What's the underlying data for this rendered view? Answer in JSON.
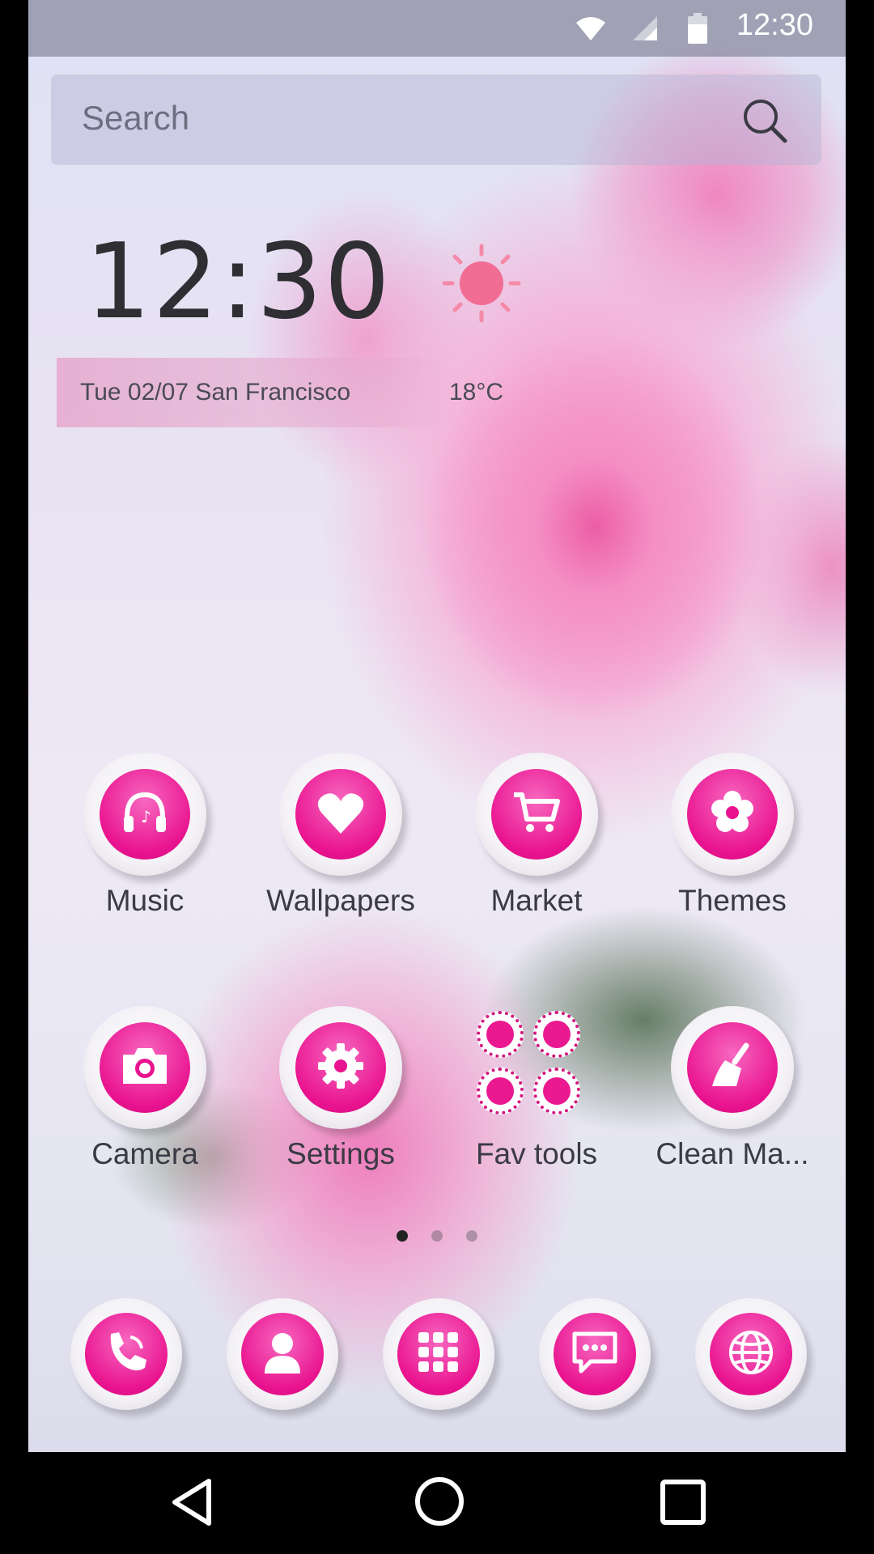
{
  "status_bar": {
    "time": "12:30",
    "icons": [
      "wifi-icon",
      "signal-icon",
      "battery-icon"
    ]
  },
  "search": {
    "placeholder": "Search",
    "icon": "search-icon"
  },
  "clock_widget": {
    "time": "12:30",
    "date_location": "Tue  02/07  San Francisco",
    "temperature": "18°C",
    "weather_icon": "sun-icon"
  },
  "apps": [
    {
      "label": "Music",
      "icon": "headphones-icon"
    },
    {
      "label": "Wallpapers",
      "icon": "heart-icon"
    },
    {
      "label": "Market",
      "icon": "cart-icon"
    },
    {
      "label": "Themes",
      "icon": "flower-icon"
    },
    {
      "label": "Camera",
      "icon": "camera-icon"
    },
    {
      "label": "Settings",
      "icon": "gear-icon"
    },
    {
      "label": "Fav tools",
      "icon": "folder-icon"
    },
    {
      "label": "Clean Ma...",
      "icon": "broom-icon"
    }
  ],
  "page_indicator": {
    "pages": 3,
    "current": 1
  },
  "dock": [
    {
      "icon": "phone-icon"
    },
    {
      "icon": "contacts-icon"
    },
    {
      "icon": "app-drawer-icon"
    },
    {
      "icon": "messages-icon"
    },
    {
      "icon": "browser-icon"
    }
  ],
  "nav_bar": {
    "icons": [
      "back-icon",
      "home-icon",
      "recents-icon"
    ]
  },
  "colors": {
    "accent_pink": "#e9138f",
    "status_bar_bg": "#6e6e82"
  }
}
